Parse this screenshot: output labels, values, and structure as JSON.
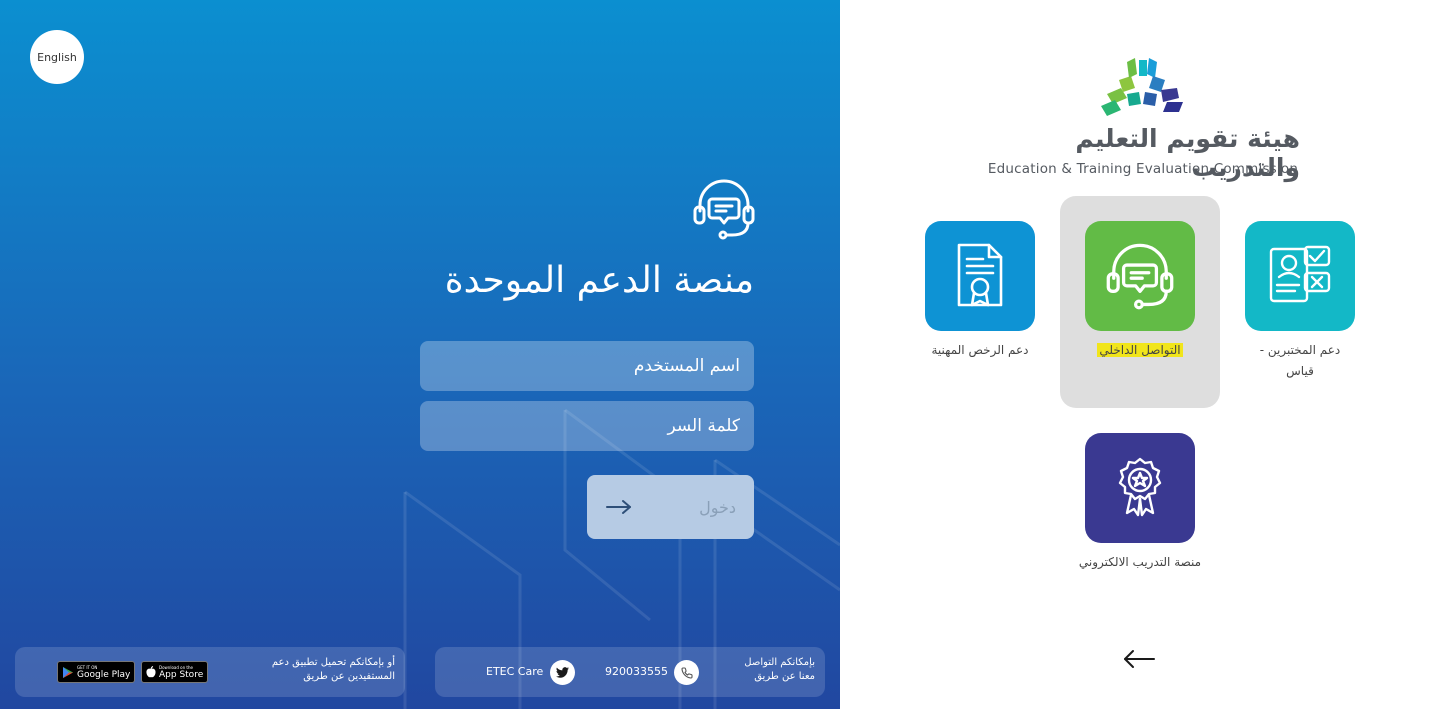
{
  "language_button": {
    "label": "English"
  },
  "login": {
    "title": "منصة الدعم الموحدة",
    "username_placeholder": "اسم المستخدم",
    "password_placeholder": "كلمة السر",
    "submit_label": "دخول"
  },
  "apps_bar": {
    "text_line1": "أو بإمكانكم تحميل تطبيق دعم",
    "text_line2": "المستفيدين عن طريق",
    "app_store": {
      "small": "Download on the",
      "big": "App Store"
    },
    "google_play": {
      "small": "GET IT ON",
      "big": "Google Play"
    }
  },
  "contact_bar": {
    "text_line1": "بإمكانكم التواصل",
    "text_line2": "معنا عن طريق",
    "phone": "920033555",
    "twitter": "ETEC Care"
  },
  "brand": {
    "name_ar": "هيئة تقويم التعليم والتدريب",
    "name_en": "Education & Training Evaluation Commission"
  },
  "services": {
    "licenses": "دعم الرخص المهنية",
    "internal": "التواصل الداخلي",
    "qiyas_line1": "دعم المختبرين -",
    "qiyas_line2": "قياس",
    "training": "منصة التدريب الالكتروني"
  },
  "colors": {
    "licenses_tile": "#0e93d4",
    "internal_tile": "#62bb46",
    "qiyas_tile": "#13b8c7",
    "training_tile": "#3a3991",
    "highlight": "#f1e51b"
  },
  "icons": {
    "support": "headset-chat-icon",
    "licenses": "certificate-icon",
    "internal": "headset-chat-icon",
    "qiyas": "exam-check-icon",
    "training": "award-badge-icon",
    "phone": "phone-icon",
    "twitter": "twitter-icon",
    "login_arrow": "arrow-right-icon",
    "back": "arrow-left-icon"
  }
}
